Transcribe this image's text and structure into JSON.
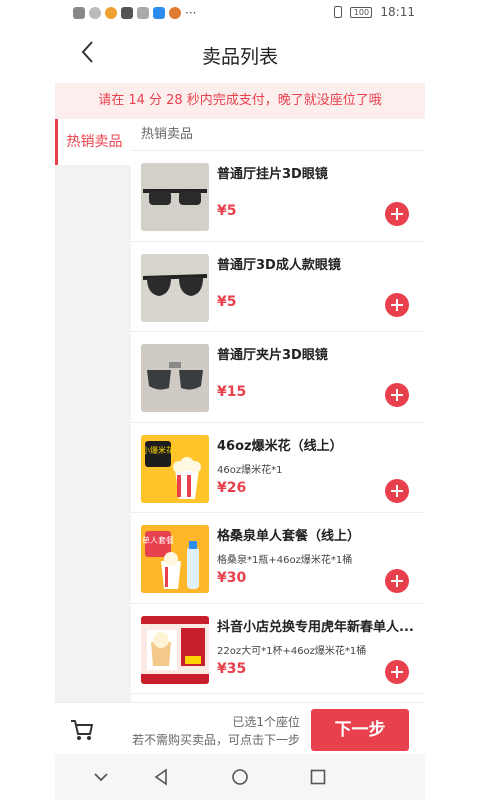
{
  "status_bar": {
    "time": "18:11",
    "battery": "100",
    "dots": "···"
  },
  "header": {
    "title": "卖品列表"
  },
  "notice": {
    "text": "请在 14 分 28 秒内完成支付，晚了就没座位了哦"
  },
  "sidebar": {
    "items": [
      {
        "label": "热销卖品"
      }
    ]
  },
  "section": {
    "title": "热销卖品"
  },
  "products": [
    {
      "name": "普通厅挂片3D眼镜",
      "desc": "",
      "price": "¥5",
      "thumb": "glasses"
    },
    {
      "name": "普通厅3D成人款眼镜",
      "desc": "",
      "price": "¥5",
      "thumb": "glasses"
    },
    {
      "name": "普通厅夹片3D眼镜",
      "desc": "",
      "price": "¥15",
      "thumb": "glasses"
    },
    {
      "name": "46oz爆米花（线上）",
      "desc": "46oz爆米花*1",
      "price": "¥26",
      "thumb": "popcorn"
    },
    {
      "name": "格桑泉单人套餐（线上）",
      "desc": "格桑泉*1瓶+46oz爆米花*1桶",
      "price": "¥30",
      "thumb": "combo"
    },
    {
      "name": "抖音小店兑换专用虎年新春单人...",
      "desc": "22oz大可*1杯+46oz爆米花*1桶",
      "price": "¥35",
      "thumb": "tiktok"
    }
  ],
  "thumb_text": {
    "popcorn": "小爆米花",
    "combo": "单人套餐"
  },
  "footer": {
    "selected": "已选1个座位",
    "hint": "若不需购买卖品，可点击下一步",
    "next": "下一步"
  },
  "colors": {
    "accent": "#e8414d",
    "notice_bg": "#fdeeee",
    "sidebar_bg": "#f2f2f2"
  },
  "icons": [
    "back-arrow-icon",
    "add-icon",
    "cart-icon",
    "nav-back-icon",
    "nav-home-icon",
    "nav-recents-icon",
    "nav-collapse-icon"
  ]
}
